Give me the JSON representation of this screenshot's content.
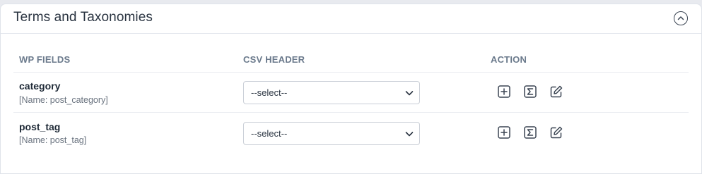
{
  "section": {
    "title": "Terms and Taxonomies"
  },
  "table": {
    "headers": {
      "wp_fields": "WP FIELDS",
      "csv_header": "CSV HEADER",
      "action": "ACTION"
    },
    "rows": [
      {
        "field": "category",
        "name_hint": "[Name: post_category]",
        "csv_select": "--select--"
      },
      {
        "field": "post_tag",
        "name_hint": "[Name: post_tag]",
        "csv_select": "--select--"
      }
    ],
    "action_icons": [
      "plus-square-icon",
      "sigma-icon",
      "edit-icon"
    ]
  },
  "colors": {
    "icon": "#3a4452",
    "header_text": "#6b7a8c",
    "border": "#c9ced6"
  }
}
